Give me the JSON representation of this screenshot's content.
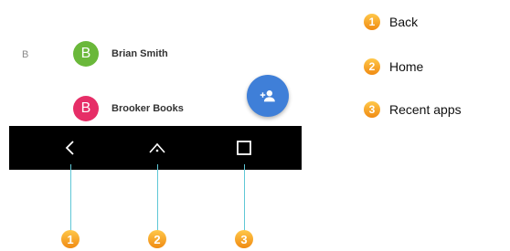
{
  "contacts": {
    "section_letter": "B",
    "items": [
      {
        "initial": "B",
        "name": "Brian Smith",
        "color": "#6ab83a"
      },
      {
        "initial": "B",
        "name": "Brooker Books",
        "color": "#e62e67"
      }
    ]
  },
  "fab": {
    "icon": "add-contact-icon",
    "color": "#3f7fd8"
  },
  "navbar": {
    "buttons": [
      {
        "icon": "back-icon",
        "number": "1"
      },
      {
        "icon": "home-icon",
        "number": "2"
      },
      {
        "icon": "recent-apps-icon",
        "number": "3"
      }
    ]
  },
  "legend": [
    {
      "number": "1",
      "label": "Back"
    },
    {
      "number": "2",
      "label": "Home"
    },
    {
      "number": "3",
      "label": "Recent apps"
    }
  ],
  "colors": {
    "badge_top": "#ffc84a",
    "badge_bottom": "#f08a12",
    "callout_line": "#5fc7d6",
    "navbar_bg": "#000000"
  }
}
